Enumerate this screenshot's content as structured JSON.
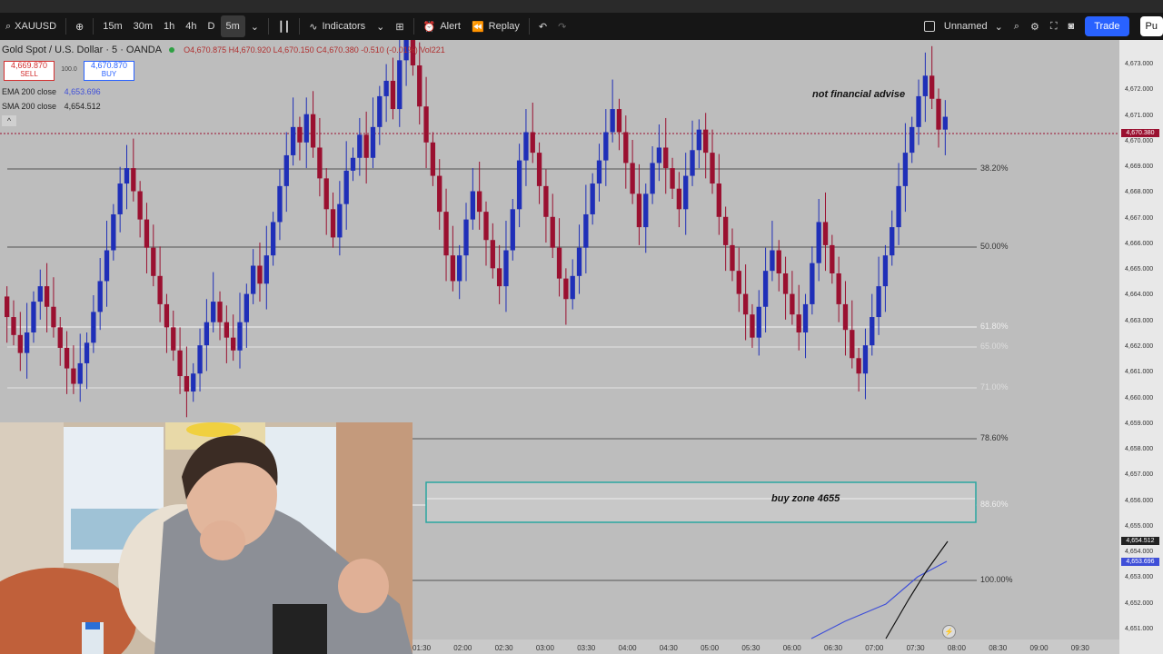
{
  "toolbar": {
    "symbol": "XAUUSD",
    "intervals": [
      "15m",
      "30m",
      "1h",
      "4h",
      "D",
      "5m"
    ],
    "active_interval": "5m",
    "indicators_label": "Indicators",
    "alert_label": "Alert",
    "replay_label": "Replay",
    "layout_name": "Unnamed",
    "trade_label": "Trade",
    "publish_label": "Pu"
  },
  "legend": {
    "title": "Gold Spot / U.S. Dollar · 5 · OANDA",
    "ohlc": "O4,670.875 H4,670.920 L4,670.150 C4,670.380 -0.510 (-0.01%) Vol221",
    "sell_price": "4,669.870",
    "sell_label": "SELL",
    "spread": "100.0",
    "buy_price": "4,670.870",
    "buy_label": "BUY",
    "ema_label": "EMA 200 close",
    "ema_value": "4,653.696",
    "sma_label": "SMA 200 close",
    "sma_value": "4,654.512",
    "collapse_glyph": "^"
  },
  "annotations": {
    "note": "not financial advise",
    "buy_zone": "buy zone 4655"
  },
  "fib_levels": [
    {
      "label": "38.20%"
    },
    {
      "label": "50.00%"
    },
    {
      "label": "61.80%"
    },
    {
      "label": "65.00%"
    },
    {
      "label": "71.00%"
    },
    {
      "label": "78.60%"
    },
    {
      "label": "88.60%"
    },
    {
      "label": "100.00%"
    }
  ],
  "price_axis": [
    "4,673.000",
    "4,672.000",
    "4,671.000",
    "4,670.000",
    "4,669.000",
    "4,668.000",
    "4,667.000",
    "4,666.000",
    "4,665.000",
    "4,664.000",
    "4,663.000",
    "4,662.000",
    "4,661.000",
    "4,660.000",
    "4,659.000",
    "4,658.000",
    "4,657.000",
    "4,656.000",
    "4,655.000",
    "4,654.000",
    "4,653.000",
    "4,652.000",
    "4,651.000"
  ],
  "price_badges": {
    "last": "4,670.380",
    "sma": "4,654.512",
    "ema": "4,653.696"
  },
  "time_axis": [
    "01:30",
    "02:00",
    "02:30",
    "03:00",
    "03:30",
    "04:00",
    "04:30",
    "05:00",
    "05:30",
    "06:00",
    "06:30",
    "07:00",
    "07:30",
    "08:00",
    "08:30",
    "09:00",
    "09:30"
  ],
  "colors": {
    "up": "#1f2fb8",
    "down": "#9a1030",
    "sell": "#d32f2f",
    "buy": "#2962ff",
    "zone_border": "#2aa6a0"
  }
}
